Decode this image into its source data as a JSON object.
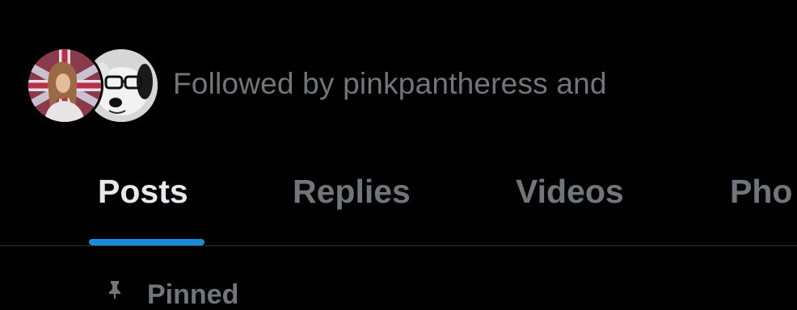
{
  "followed_by": {
    "text": "Followed by pinkpantheress and",
    "avatars": [
      {
        "icon": "user-avatar-icon",
        "description": "pinkpantheress"
      },
      {
        "icon": "plush-dog-avatar-icon"
      }
    ]
  },
  "tabs": [
    {
      "label": "Posts",
      "active": true
    },
    {
      "label": "Replies",
      "active": false
    },
    {
      "label": "Videos",
      "active": false
    },
    {
      "label": "Pho",
      "active": false
    }
  ],
  "pinned": {
    "icon": "pin-icon",
    "label": "Pinned"
  },
  "colors": {
    "background": "#000000",
    "primary_text": "#e7e9ea",
    "secondary_text": "#71767b",
    "accent": "#1d9bf0",
    "divider": "#2f3336"
  }
}
